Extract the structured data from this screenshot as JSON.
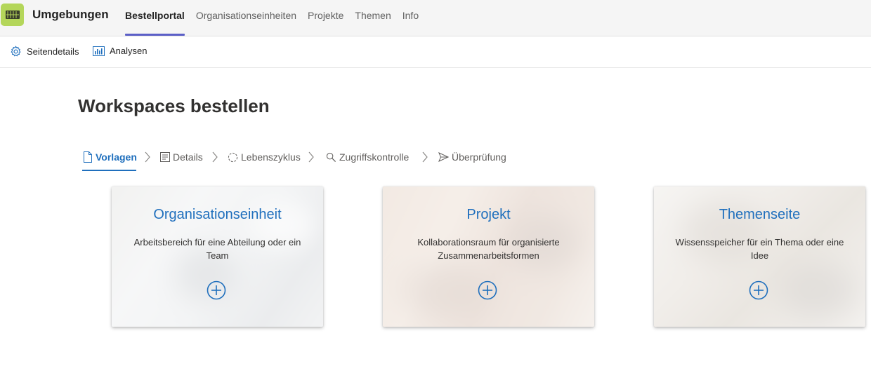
{
  "app": {
    "title": "Umgebungen"
  },
  "nav": [
    {
      "label": "Bestellportal",
      "active": true
    },
    {
      "label": "Organisationseinheiten",
      "active": false
    },
    {
      "label": "Projekte",
      "active": false
    },
    {
      "label": "Themen",
      "active": false
    },
    {
      "label": "Info",
      "active": false
    }
  ],
  "commands": {
    "page_details": "Seitendetails",
    "analytics": "Analysen"
  },
  "page": {
    "title": "Workspaces bestellen"
  },
  "steps": [
    {
      "label": "Vorlagen",
      "icon": "document-icon",
      "active": true
    },
    {
      "label": "Details",
      "icon": "form-icon",
      "active": false
    },
    {
      "label": "Lebenszyklus",
      "icon": "cycle-icon",
      "active": false
    },
    {
      "label": "Zugriffskontrolle",
      "icon": "key-search-icon",
      "active": false
    },
    {
      "label": "Überprüfung",
      "icon": "send-icon",
      "active": false
    }
  ],
  "templates": [
    {
      "title": "Organisationseinheit",
      "description": "Arbeitsbereich für eine Abteilung oder ein Team",
      "action_icon": "add-circle-icon"
    },
    {
      "title": "Projekt",
      "description": "Kollaborationsraum für organisierte Zusammenarbeitsformen",
      "action_icon": "add-circle-icon"
    },
    {
      "title": "Themenseite",
      "description": "Wissensspeicher für ein Thema oder eine Idee",
      "action_icon": "add-circle-icon"
    }
  ],
  "colors": {
    "accent": "#1f6fbd",
    "nav_indicator": "#5b5fc7",
    "logo_bg": "#b4d65a"
  }
}
